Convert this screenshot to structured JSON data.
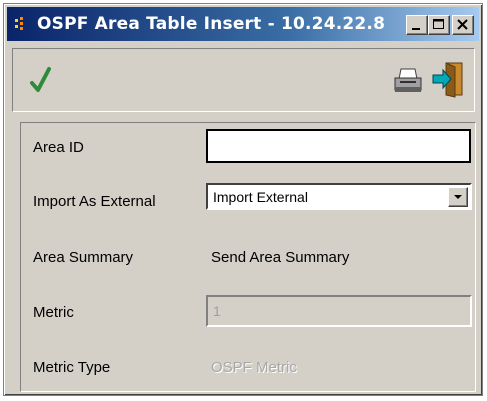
{
  "window": {
    "title": "OSPF Area Table Insert - 10.24.22.8"
  },
  "toolbar": {
    "apply": "checkmark-icon",
    "print": "printer-icon",
    "exit": "exit-door-icon"
  },
  "form": {
    "area_id": {
      "label": "Area ID",
      "value": ""
    },
    "import_as_external": {
      "label": "Import As External",
      "selected": "Import External"
    },
    "area_summary": {
      "label": "Area Summary",
      "value": "Send Area Summary"
    },
    "metric": {
      "label": "Metric",
      "value": "1"
    },
    "metric_type": {
      "label": "Metric Type",
      "value": "OSPF Metric"
    }
  },
  "colors": {
    "titlebar_start": "#0a246a",
    "titlebar_end": "#a6caf0",
    "window_bg": "#d4d0c8",
    "check_green": "#2e8b3a"
  }
}
